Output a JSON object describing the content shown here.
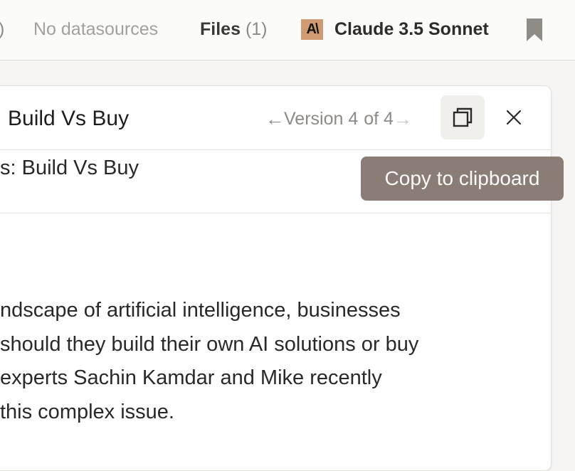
{
  "topbar": {
    "paren": ")",
    "datasources": "No datasources",
    "files_label": "Files",
    "files_count": "(1)",
    "model_logo": "A\\",
    "model_name": "Claude 3.5 Sonnet",
    "icons": [
      "anthropic-logo-icon",
      "bookmark-icon"
    ]
  },
  "artifact": {
    "title": "Build Vs Buy",
    "version_label": "Version 4",
    "version_of": "of 4",
    "copy_icon": "copy-icon",
    "close_icon": "close-icon"
  },
  "tooltip": {
    "text": "Copy to clipboard"
  },
  "document": {
    "heading": "s: Build Vs Buy",
    "lines": [
      "ndscape of artificial intelligence, businesses",
      "should they build their own AI solutions or buy",
      "experts Sachin Kamdar and Mike recently",
      "this complex issue."
    ]
  },
  "colors": {
    "tooltip_bg": "#8a7d75",
    "logo_bg": "#d09a73",
    "muted_text": "#8d8a86"
  }
}
